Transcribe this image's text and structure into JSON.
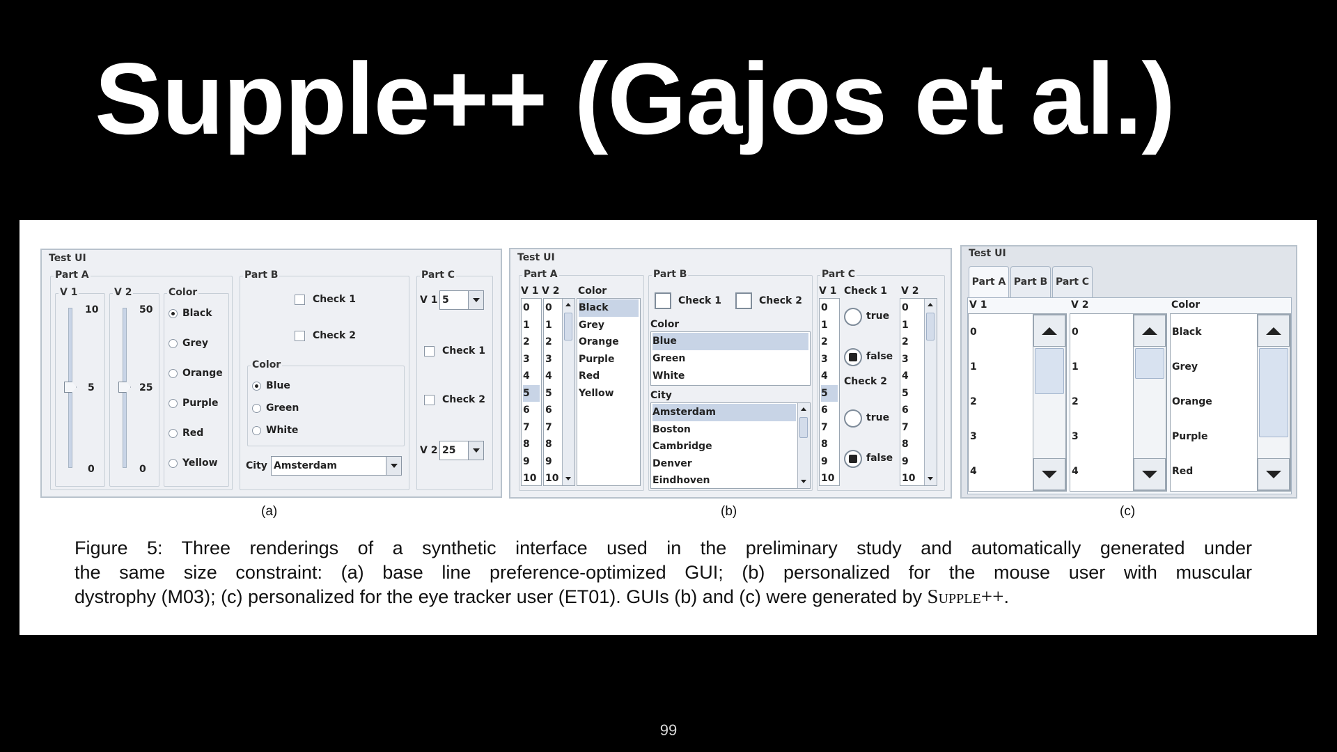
{
  "slide": {
    "title": "Supple++ (Gajos et al.)",
    "page_number": "99"
  },
  "figure": {
    "window_title": "Test UI",
    "panel_a": {
      "part_a": "Part A",
      "v1": "V 1",
      "v2": "V 2",
      "v1_ticks": [
        "10",
        "5",
        "0"
      ],
      "v2_ticks": [
        "50",
        "25",
        "0"
      ],
      "v1_value": 5,
      "v2_value": 25,
      "color_label": "Color",
      "colors": [
        "Black",
        "Grey",
        "Orange",
        "Purple",
        "Red",
        "Yellow"
      ],
      "selected_color": "Black",
      "part_b": "Part B",
      "check1": "Check 1",
      "check2": "Check 2",
      "color_b_label": "Color",
      "colors_b": [
        "Blue",
        "Green",
        "White"
      ],
      "selected_color_b": "Blue",
      "city_label": "City",
      "city_value": "Amsterdam",
      "part_c": "Part C",
      "v1_combo": "5",
      "v2_combo": "25"
    },
    "panel_b": {
      "part_a": "Part A",
      "v1": "V 1",
      "v2": "V 2",
      "numbers": [
        "0",
        "1",
        "2",
        "3",
        "4",
        "5",
        "6",
        "7",
        "8",
        "9",
        "10"
      ],
      "color_label": "Color",
      "colors": [
        "Black",
        "Grey",
        "Orange",
        "Purple",
        "Red",
        "Yellow"
      ],
      "part_b": "Part B",
      "check1": "Check 1",
      "check2": "Check 2",
      "color_b_label": "Color",
      "colors_b": [
        "Blue",
        "Green",
        "White"
      ],
      "city_label": "City",
      "cities": [
        "Amsterdam",
        "Boston",
        "Cambridge",
        "Denver",
        "Eindhoven"
      ],
      "part_c": "Part C",
      "check1_c": "Check 1",
      "check2_c": "Check 2",
      "true_label": "true",
      "false_label": "false"
    },
    "panel_c": {
      "tabs": [
        "Part A",
        "Part B",
        "Part C"
      ],
      "v1": "V 1",
      "v2": "V 2",
      "color_label": "Color",
      "numbers": [
        "0",
        "1",
        "2",
        "3",
        "4"
      ],
      "colors": [
        "Black",
        "Grey",
        "Orange",
        "Purple",
        "Red"
      ]
    },
    "sublabels": [
      "(a)",
      "(b)",
      "(c)"
    ],
    "caption_lines": [
      "Figure 5:  Three renderings of a synthetic interface used in the preliminary study and automatically generated under",
      "the same size constraint:  (a) base line preference-optimized GUI; (b) personalized for the mouse user with muscular",
      "dystrophy (M03); (c) personalized for the eye tracker user (ET01).  GUIs (b) and (c) were generated by "
    ],
    "caption_smallcaps": "Supple++",
    "caption_end": "."
  }
}
